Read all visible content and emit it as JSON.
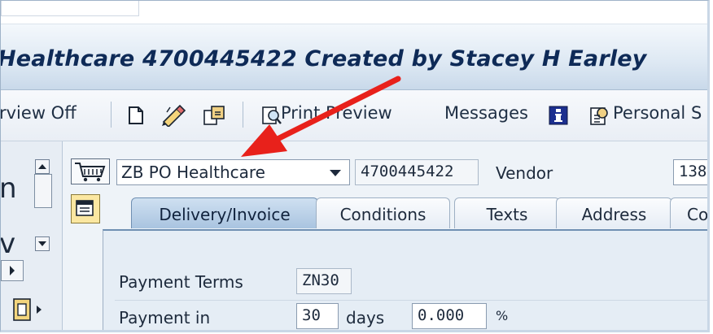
{
  "title": "Healthcare 4700445422 Created by Stacey H Earley",
  "toolbar": {
    "overview_label": "rview Off",
    "print_preview_label": "Print Preview",
    "messages_label": "Messages",
    "personal_label": "Personal S"
  },
  "header": {
    "doc_type_value": "ZB PO Healthcare",
    "po_number_value": "4700445422",
    "vendor_label": "Vendor",
    "vendor_value": "138"
  },
  "left_panel": {
    "frag1": "n",
    "frag2": "v"
  },
  "tabs": [
    {
      "label": "Delivery/Invoice",
      "active": true
    },
    {
      "label": "Conditions",
      "active": false
    },
    {
      "label": "Texts",
      "active": false
    },
    {
      "label": "Address",
      "active": false
    },
    {
      "label": "Co",
      "active": false
    }
  ],
  "delivery_invoice": {
    "payment_terms_label": "Payment Terms",
    "payment_terms_value": "ZN30",
    "payment_in_label": "Payment in",
    "payment_in_days_value": "30",
    "days_label": "days",
    "percent_value": "0.000",
    "percent_unit": "%"
  },
  "colors": {
    "title_text": "#0e2a57",
    "active_tab": "#a9c4e0",
    "annotation_arrow": "#e8211b"
  },
  "icons": [
    "new-document-icon",
    "edit-pencil-icon",
    "other-document-icon",
    "print-preview-icon",
    "info-icon",
    "personal-settings-icon",
    "cart-icon",
    "header-toggle-icon",
    "annotation-arrow"
  ]
}
